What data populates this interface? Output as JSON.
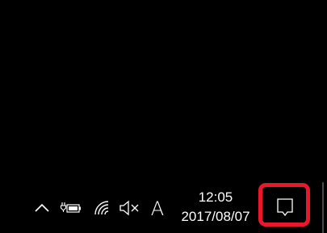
{
  "taskbar": {
    "tray_icons": {
      "chevron": "chevron-up-icon",
      "battery": "battery-charging-icon",
      "wifi": "wifi-icon",
      "volume": "volume-muted-icon",
      "ime_label": "A"
    },
    "clock": {
      "time": "12:05",
      "date": "2017/08/07"
    },
    "action_center": {
      "icon": "notification-icon",
      "highlight_color": "#e8182a"
    }
  }
}
